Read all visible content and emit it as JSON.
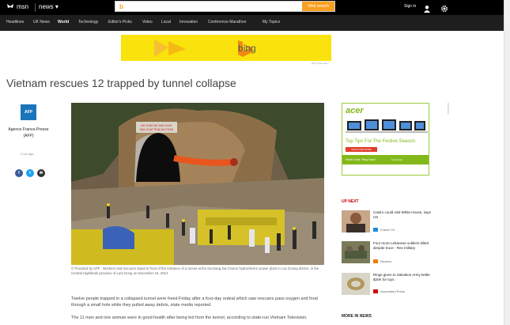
{
  "brand": {
    "logo_label": "msn",
    "section_label": "news",
    "section_caret": "▾"
  },
  "search": {
    "bing_mark": "b",
    "placeholder": "",
    "button": "Web search"
  },
  "header": {
    "signin": "Sign in"
  },
  "nav": {
    "items": [
      "Headlines",
      "UK News",
      "World",
      "Technology",
      "Editor's Picks",
      "Video",
      "Local",
      "Innovation",
      "Conference Marathon",
      "My Topics"
    ],
    "active": "World"
  },
  "ad": {
    "bing_text": "bing",
    "note": "Why these ads?"
  },
  "article": {
    "title": "Vietnam rescues 12 trapped by tunnel collapse",
    "source_logo": "AFP",
    "source": "Agence France-Presse (AFP)",
    "time": "2 hrs ago",
    "photo_sign": [
      "AN TOAN DE SAN XUAT",
      "SAN XUAT PHAI AN TOAN"
    ],
    "caption": "© Provided by AFP · Workers and rescuers stand in front of the entrance of a tunnel at the Da Dang-Da Chomo hydroelectric power plant in Lac Duong district, in the Central Highlands province of Lam Dong on December 16, 2014",
    "para1": "Twelve people trapped in a collapsed tunnel were freed Friday after a four-day ordeal which saw rescuers pass oxygen and food through a small hole while they pulled away debris, state media reported.",
    "para2": "The 11 men and one woman were in good health after being led from the tunnel, according to state-run Vietnam Television."
  },
  "share": {
    "facebook": "f",
    "twitter": "t",
    "email": "✉"
  },
  "sidebar": {
    "acer_ad": {
      "logo": "acer",
      "headline": "Top Tips For The Festive Season",
      "discover": "DISCOVER MORE",
      "work_play": "Work hard. Play hard.",
      "intel": "Intel Inside"
    },
    "ads_badge": "AdChoices",
    "up_next_label": "UP NEXT",
    "items": [
      {
        "title": "Castro could visit White House, says US",
        "source": "France 24"
      },
      {
        "title": "Four more Lebanese soldiers killed despite truce - Rev military",
        "source": "Reuters"
      },
      {
        "title": "Rings given to Salvation Army kettle $20K for toys",
        "source": "Associated Press"
      }
    ],
    "more_label": "MORE IN NEWS"
  },
  "colors": {
    "accent": "#f8a01f",
    "bing_yellow": "#fae30c",
    "acer_green": "#83b81a",
    "afp_blue": "#1b75bb",
    "upnext_red": "#cc0000"
  }
}
